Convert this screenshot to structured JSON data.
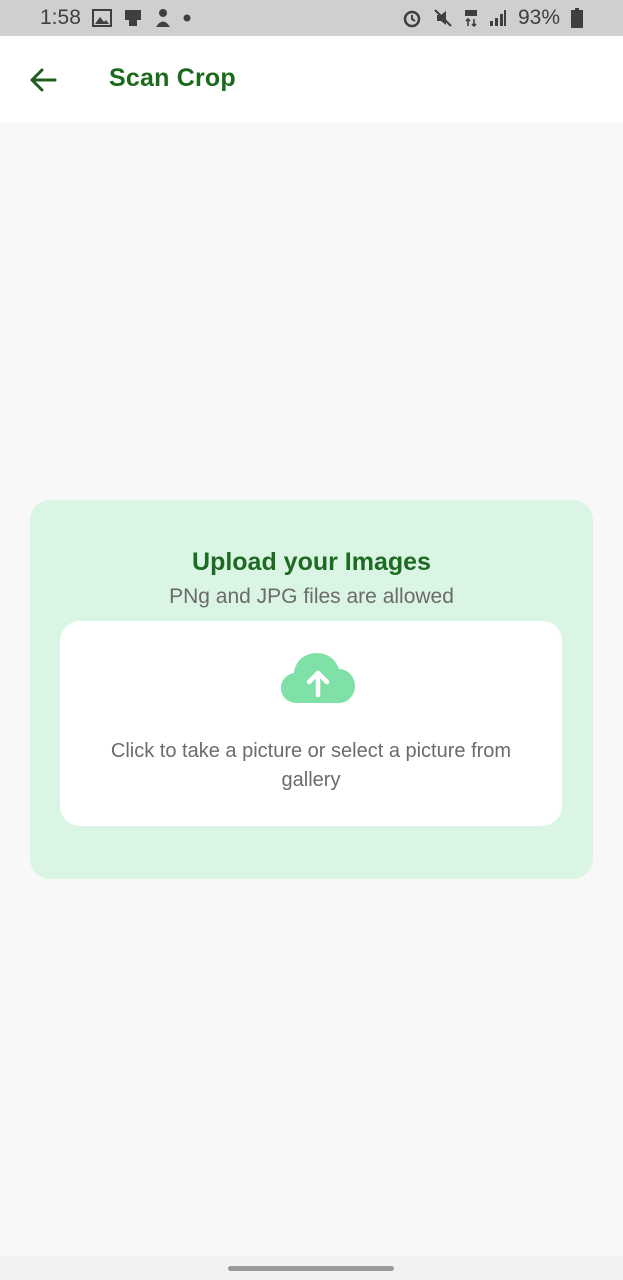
{
  "status_bar": {
    "time": "1:58",
    "battery": "93%",
    "left_icons": [
      "image-icon",
      "device-icon",
      "mascot-icon",
      "dot-icon"
    ],
    "right_icons": [
      "alarm-icon",
      "mute-icon",
      "network-4g-icon",
      "signal-icon",
      "battery-icon"
    ]
  },
  "app_bar": {
    "title": "Scan Crop",
    "back_icon": "arrow-left-icon"
  },
  "upload": {
    "title": "Upload your Images",
    "subtitle": "PNg and JPG files are allowed",
    "icon": "cloud-upload-icon",
    "prompt": "Click to take a picture or select a picture from gallery"
  },
  "colors": {
    "accent": "#1b6a1b",
    "card_bg": "#daf5e4",
    "cloud": "#7fe0a8"
  }
}
